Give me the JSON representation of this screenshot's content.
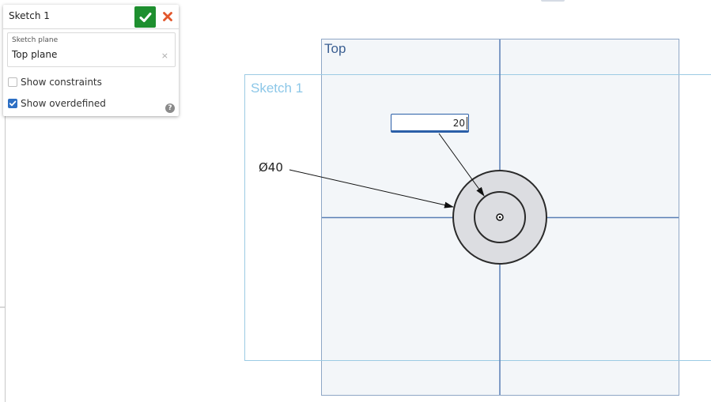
{
  "panel": {
    "title": "Sketch 1",
    "sketch_plane_label": "Sketch plane",
    "sketch_plane_value": "Top plane",
    "clear_glyph": "×",
    "options": [
      {
        "label": "Show constraints",
        "checked": false
      },
      {
        "label": "Show overdefined",
        "checked": true
      }
    ],
    "help_glyph": "?"
  },
  "viewport": {
    "plane_label": "Top",
    "sketch_label": "Sketch 1",
    "diameter_dimension": "Ø40",
    "dimension_input_value": "20"
  },
  "colors": {
    "accept": "#1e8f2f",
    "cancel": "#e2562b",
    "plane_fill": "#f3f6f9",
    "plane_stroke": "#8fa7c6",
    "axis": "#5a7fb5",
    "sketch_stroke": "#9ccbe4",
    "sketch_label": "#8cc7e8",
    "circle_fill": "#dcdde1",
    "input_border": "#2b5fa8"
  },
  "icons": {
    "accept": "check-icon",
    "cancel": "close-icon",
    "help": "help-icon"
  }
}
